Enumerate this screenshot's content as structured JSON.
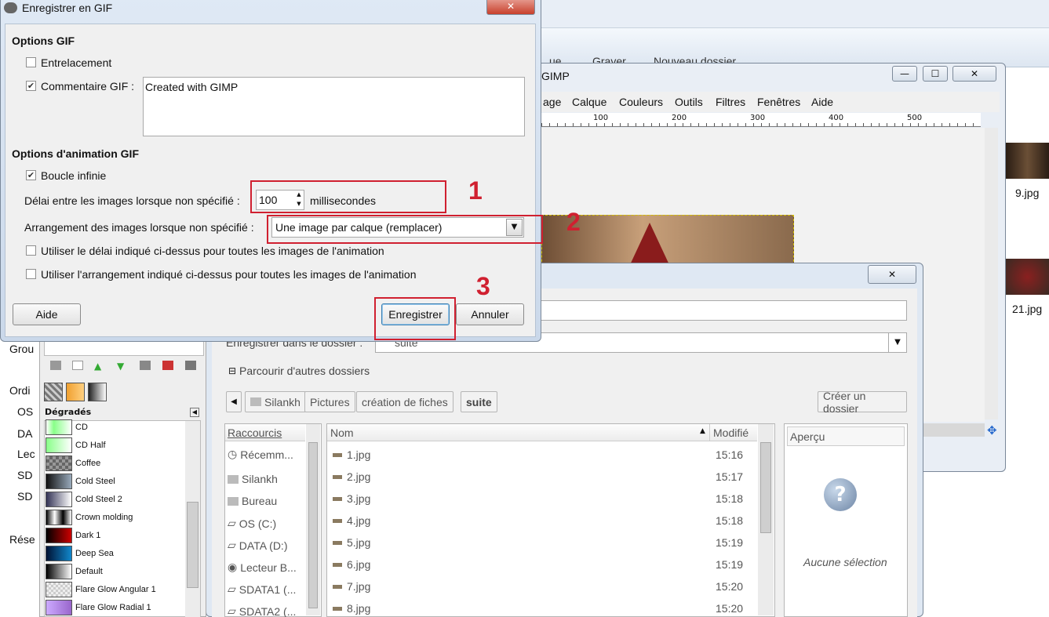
{
  "gif_dialog": {
    "title": "Enregistrer en GIF",
    "options_heading": "Options GIF",
    "interlace_label": "Entrelacement",
    "comment_label": "Commentaire GIF :",
    "comment_value": "Created with GIMP",
    "anim_heading": "Options d'animation GIF",
    "loop_label": "Boucle infinie",
    "delay_label": "Délai entre les images lorsque non spécifié :",
    "delay_value": "100",
    "delay_unit": "millisecondes",
    "arrangement_label": "Arrangement des images lorsque non spécifié :",
    "arrangement_value": "Une image par calque (remplacer)",
    "use_delay_label": "Utiliser le délai indiqué ci-dessus pour toutes les images de l'animation",
    "use_arrangement_label": "Utiliser l'arrangement indiqué ci-dessus pour toutes les images de l'animation",
    "help_button": "Aide",
    "save_button": "Enregistrer",
    "cancel_button": "Annuler",
    "interlace_checked": false,
    "comment_checked": true,
    "loop_checked": true,
    "use_delay_checked": false,
    "use_arrangement_checked": false
  },
  "annotations": {
    "n1": "1",
    "n2": "2",
    "n3": "3"
  },
  "gimp_window": {
    "title": "GIMP",
    "menu": [
      "age",
      "Calque",
      "Couleurs",
      "Outils",
      "Filtres",
      "Fenêtres",
      "Aide"
    ],
    "ruler_labels": [
      "100",
      "200",
      "300",
      "400",
      "500"
    ]
  },
  "background": {
    "toolbar_items": [
      "ue",
      "Graver",
      "Nouveau dossier"
    ],
    "thumbnails": [
      "9.jpg",
      "21.jpg"
    ],
    "left_nav": [
      "Grou",
      "Ordi",
      "OS",
      "DA",
      "Lec",
      "SD",
      "SD",
      "Rése"
    ]
  },
  "gradients_panel": {
    "title": "Dégradés",
    "items": [
      "CD",
      "CD Half",
      "Coffee",
      "Cold Steel",
      "Cold Steel 2",
      "Crown molding",
      "Dark 1",
      "Deep Sea",
      "Default",
      "Flare Glow Angular 1",
      "Flare Glow Radial 1"
    ]
  },
  "save_dialog": {
    "folder_label": "Enregistrer dans le dossier :",
    "folder_value": "suite",
    "browse_label": "Parcourir d'autres dossiers",
    "breadcrumb": [
      "Silankh",
      "Pictures",
      "création de fiches",
      "suite"
    ],
    "create_folder": "Créer un dossier",
    "shortcuts_header": "Raccourcis",
    "shortcuts": [
      "Récemm...",
      "Silankh",
      "Bureau",
      "OS (C:)",
      "DATA (D:)",
      "Lecteur B...",
      "SDATA1 (...",
      "SDATA2 (..."
    ],
    "col_name": "Nom",
    "col_modified": "Modifié",
    "files": [
      {
        "name": "1.jpg",
        "time": "15:16"
      },
      {
        "name": "2.jpg",
        "time": "15:17"
      },
      {
        "name": "3.jpg",
        "time": "15:18"
      },
      {
        "name": "4.jpg",
        "time": "15:18"
      },
      {
        "name": "5.jpg",
        "time": "15:19"
      },
      {
        "name": "6.jpg",
        "time": "15:19"
      },
      {
        "name": "7.jpg",
        "time": "15:20"
      },
      {
        "name": "8.jpg",
        "time": "15:20"
      }
    ],
    "preview_header": "Aperçu",
    "no_selection": "Aucune sélection"
  },
  "colors": {
    "annotation_red": "#d02030",
    "dialog_bg": "#f0f0f0"
  }
}
